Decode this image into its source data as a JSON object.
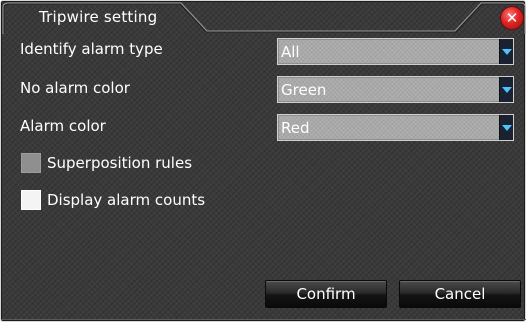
{
  "dialog": {
    "title": "Tripwire setting",
    "close_symbol": "✕"
  },
  "fields": [
    {
      "label": "Identify alarm type",
      "value": "All"
    },
    {
      "label": "No alarm color",
      "value": "Green"
    },
    {
      "label": "Alarm color",
      "value": "Red"
    }
  ],
  "checkboxes": [
    {
      "label": "Superposition rules",
      "checked": false,
      "disabled": true
    },
    {
      "label": "Display alarm counts",
      "checked": false,
      "disabled": false
    }
  ],
  "buttons": {
    "confirm": "Confirm",
    "cancel": "Cancel"
  },
  "colors": {
    "accent_arrow": "#4ec1ff",
    "close_button": "#e02424",
    "select_background": "#a9a9a9"
  },
  "icons": {
    "close": "close-icon",
    "dropdown": "chevron-down-icon"
  }
}
